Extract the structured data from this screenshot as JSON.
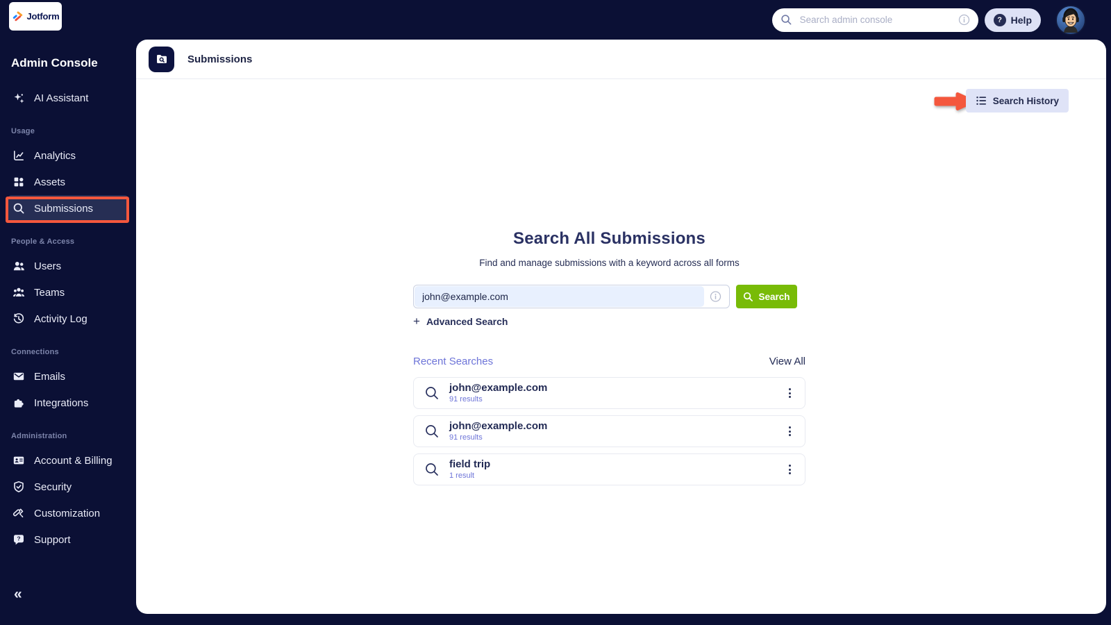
{
  "topbar": {
    "logo_text": "Jotform",
    "search_placeholder": "Search admin console",
    "help_label": "Help"
  },
  "sidebar": {
    "title": "Admin Console",
    "ai_item": {
      "label": "AI Assistant",
      "icon": "sparkles-icon"
    },
    "sections": [
      {
        "label": "Usage",
        "items": [
          {
            "label": "Analytics",
            "icon": "line-chart-icon",
            "active": false
          },
          {
            "label": "Assets",
            "icon": "grid-icon",
            "active": false
          },
          {
            "label": "Submissions",
            "icon": "magnifier-icon",
            "active": true
          }
        ]
      },
      {
        "label": "People & Access",
        "items": [
          {
            "label": "Users",
            "icon": "users-icon",
            "active": false
          },
          {
            "label": "Teams",
            "icon": "teams-icon",
            "active": false
          },
          {
            "label": "Activity Log",
            "icon": "clock-history-icon",
            "active": false
          }
        ]
      },
      {
        "label": "Connections",
        "items": [
          {
            "label": "Emails",
            "icon": "envelope-icon",
            "active": false
          },
          {
            "label": "Integrations",
            "icon": "puzzle-icon",
            "active": false
          }
        ]
      },
      {
        "label": "Administration",
        "items": [
          {
            "label": "Account & Billing",
            "icon": "id-card-icon",
            "active": false
          },
          {
            "label": "Security",
            "icon": "shield-check-icon",
            "active": false
          },
          {
            "label": "Customization",
            "icon": "paint-roller-icon",
            "active": false
          },
          {
            "label": "Support",
            "icon": "chat-question-icon",
            "active": false
          }
        ]
      }
    ],
    "collapse_icon": "«"
  },
  "header": {
    "title": "Submissions",
    "icon": "folder-search-icon"
  },
  "main": {
    "search_history_label": "Search History",
    "title": "Search All Submissions",
    "subtitle": "Find and manage submissions with a keyword across all forms",
    "search": {
      "value": "john@example.com",
      "button_label": "Search"
    },
    "advanced": {
      "plus": "+",
      "label": "Advanced Search"
    },
    "recent": {
      "title": "Recent Searches",
      "view_all_label": "View All",
      "items": [
        {
          "query": "john@example.com",
          "results": "91 results"
        },
        {
          "query": "john@example.com",
          "results": "91 results"
        },
        {
          "query": "field trip",
          "results": "1 result"
        }
      ]
    }
  },
  "colors": {
    "navy_bg": "#0b1035",
    "active_row": "#262e54",
    "annotation_red": "#f4573d",
    "button_green": "#78bb07",
    "lavender": "#dfe3f7",
    "link_purple": "#6d74d8",
    "title_navy": "#2a3163"
  }
}
